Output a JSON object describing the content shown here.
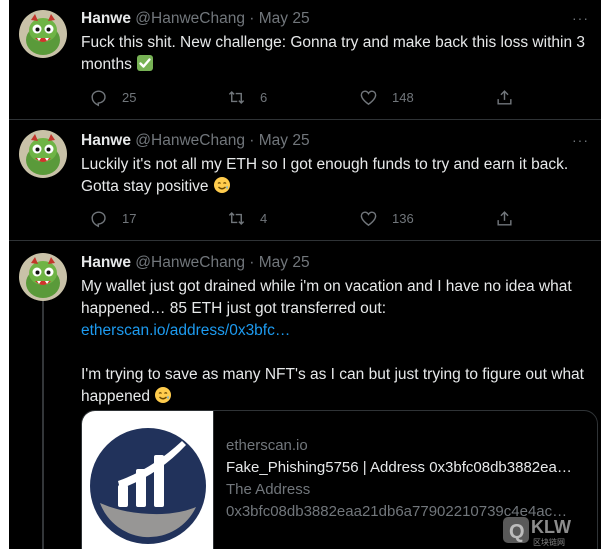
{
  "tweets": [
    {
      "name": "Hanwe",
      "handle": "@HanweChang",
      "sep": "·",
      "date": "May 25",
      "text": "Fuck this shit. New challenge: Gonna try and make back this loss within 3 months",
      "emoji": "check-mark-emoji",
      "replies": "25",
      "retweets": "6",
      "likes": "148"
    },
    {
      "name": "Hanwe",
      "handle": "@HanweChang",
      "sep": "·",
      "date": "May 25",
      "text": "Luckily it's not all my ETH so I got enough funds to try and earn it back. Gotta stay positive",
      "emoji": "smiling-face-with-tear-emoji",
      "replies": "17",
      "retweets": "4",
      "likes": "136"
    },
    {
      "name": "Hanwe",
      "handle": "@HanweChang",
      "sep": "·",
      "date": "May 25",
      "text_1": "My wallet just got drained while i'm on vacation and I have no idea what happened… 85 ETH just got transferred out:",
      "link": "etherscan.io/address/0x3bfc…",
      "text_2": "I'm trying to save as many NFT's as I can but just trying to figure out what happened",
      "emoji": "smiling-face-with-tear-emoji",
      "card": {
        "domain": "etherscan.io",
        "title": "Fake_Phishing5756 | Address 0x3bfc08db3882ea…",
        "desc_1": "The Address",
        "desc_2": "0x3bfc08db3882eaa21db6a77902210739c4e4ac…",
        "logo": "etherscan-logo"
      }
    }
  ],
  "more_label": "···",
  "watermark": {
    "text": "QKLW",
    "subtext": "区块链网"
  },
  "colors": {
    "background": "#000000",
    "text": "#e7e9ea",
    "muted": "#71767b",
    "link": "#1d9bf0",
    "divider": "#2f3336"
  }
}
